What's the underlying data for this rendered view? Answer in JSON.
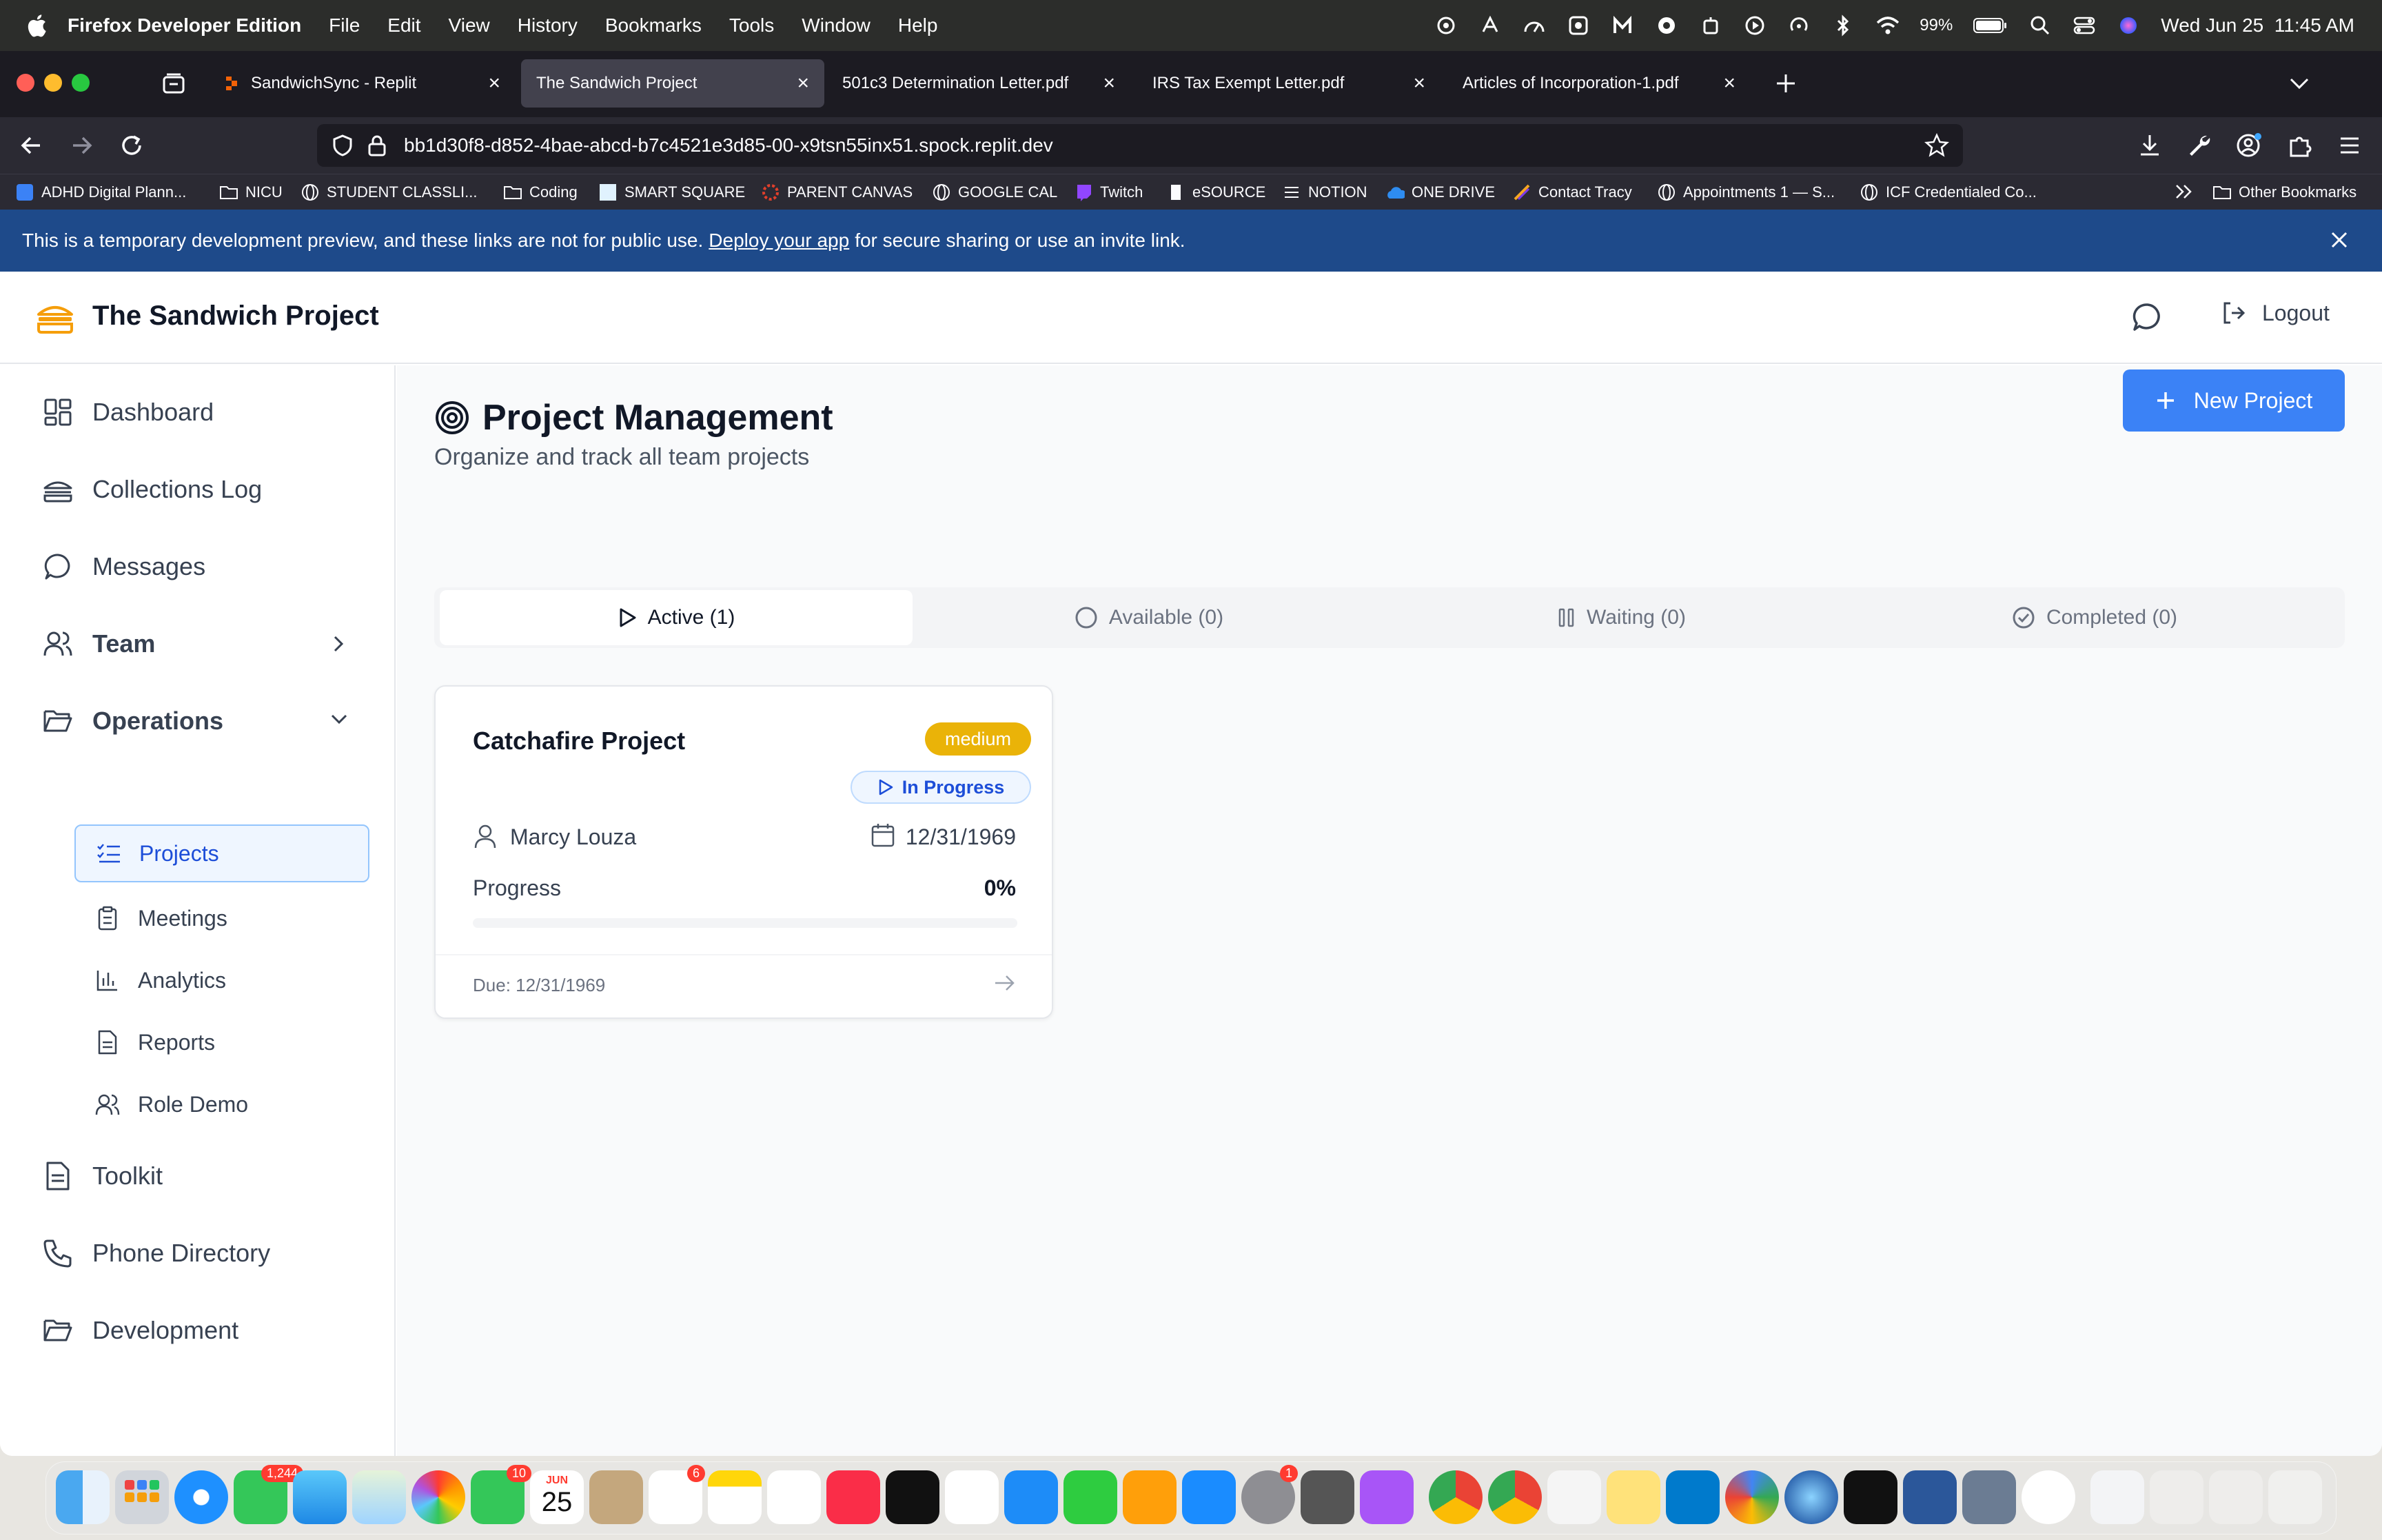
{
  "menubar": {
    "app_name": "Firefox Developer Edition",
    "items": [
      "File",
      "Edit",
      "View",
      "History",
      "Bookmarks",
      "Tools",
      "Window",
      "Help"
    ],
    "battery": "99%",
    "datetime": "Wed Jun 25  11:45 AM"
  },
  "browser": {
    "tabs": [
      {
        "label": "SandwichSync - Replit"
      },
      {
        "label": "The Sandwich Project"
      },
      {
        "label": "501c3 Determination Letter.pdf"
      },
      {
        "label": "IRS Tax Exempt Letter.pdf"
      },
      {
        "label": "Articles of Incorporation-1.pdf"
      }
    ],
    "url": "bb1d30f8-d852-4bae-abcd-b7c4521e3d85-00-x9tsn55inx51.spock.replit.dev",
    "bookmarks": [
      "ADHD Digital Plann...",
      "NICU",
      "STUDENT CLASSLI...",
      "Coding",
      "SMART SQUARE",
      "PARENT CANVAS",
      "GOOGLE CAL",
      "Twitch",
      "eSOURCE",
      "NOTION",
      "ONE DRIVE",
      "Contact Tracy",
      "Appointments 1 — S...",
      "ICF Credentialed Co..."
    ],
    "other_bookmarks": "Other Bookmarks"
  },
  "banner": {
    "text_before": "This is a temporary development preview, and these links are not for public use.",
    "link": "Deploy your app",
    "text_after": "for secure sharing or use an invite link."
  },
  "header": {
    "title": "The Sandwich Project",
    "logout": "Logout"
  },
  "sidebar": {
    "items": [
      {
        "label": "Dashboard"
      },
      {
        "label": "Collections Log"
      },
      {
        "label": "Messages"
      },
      {
        "label": "Team"
      },
      {
        "label": "Operations"
      },
      {
        "label": "Toolkit"
      },
      {
        "label": "Phone Directory"
      },
      {
        "label": "Development"
      }
    ],
    "subitems": [
      {
        "label": "Projects"
      },
      {
        "label": "Meetings"
      },
      {
        "label": "Analytics"
      },
      {
        "label": "Reports"
      },
      {
        "label": "Role Demo"
      }
    ]
  },
  "main": {
    "title": "Project Management",
    "subtitle": "Organize and track all team projects",
    "new_button": "New Project",
    "tabs": [
      {
        "label": "Active (1)"
      },
      {
        "label": "Available (0)"
      },
      {
        "label": "Waiting (0)"
      },
      {
        "label": "Completed (0)"
      }
    ],
    "card": {
      "title": "Catchafire Project",
      "priority": "medium",
      "status": "In Progress",
      "owner": "Marcy Louza",
      "date": "12/31/1969",
      "progress_label": "Progress",
      "progress_text": "0%",
      "progress_value": 0,
      "due": "Due: 12/31/1969"
    }
  },
  "dock": {
    "messages_badge": "1,244",
    "facetime_badge": "10",
    "calendar_month": "JUN",
    "calendar_day": "25",
    "reminders_badge": "6",
    "settings_badge": "1"
  },
  "colors": {
    "accent": "#3b82f6",
    "banner": "#1e4a8a",
    "priority_medium": "#eab308",
    "logo": "#f59e0b"
  }
}
